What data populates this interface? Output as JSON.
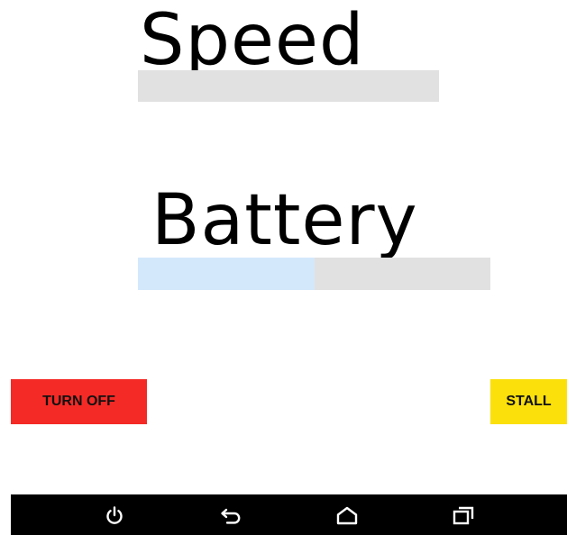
{
  "speed": {
    "label": "Speed",
    "progress": 0
  },
  "battery": {
    "label": "Battery",
    "progress": 0.5
  },
  "buttons": {
    "turn_off_label": "TURN OFF",
    "stall_label": "STALL"
  },
  "colors": {
    "track": "#e1e1e1",
    "fill": "#d4e8fb",
    "turn_off": "#f42a26",
    "stall": "#fbe00c",
    "nav_bar": "#000000"
  },
  "nav_bar": {
    "icons": [
      "power-icon",
      "back-icon",
      "home-icon",
      "recents-icon"
    ]
  }
}
